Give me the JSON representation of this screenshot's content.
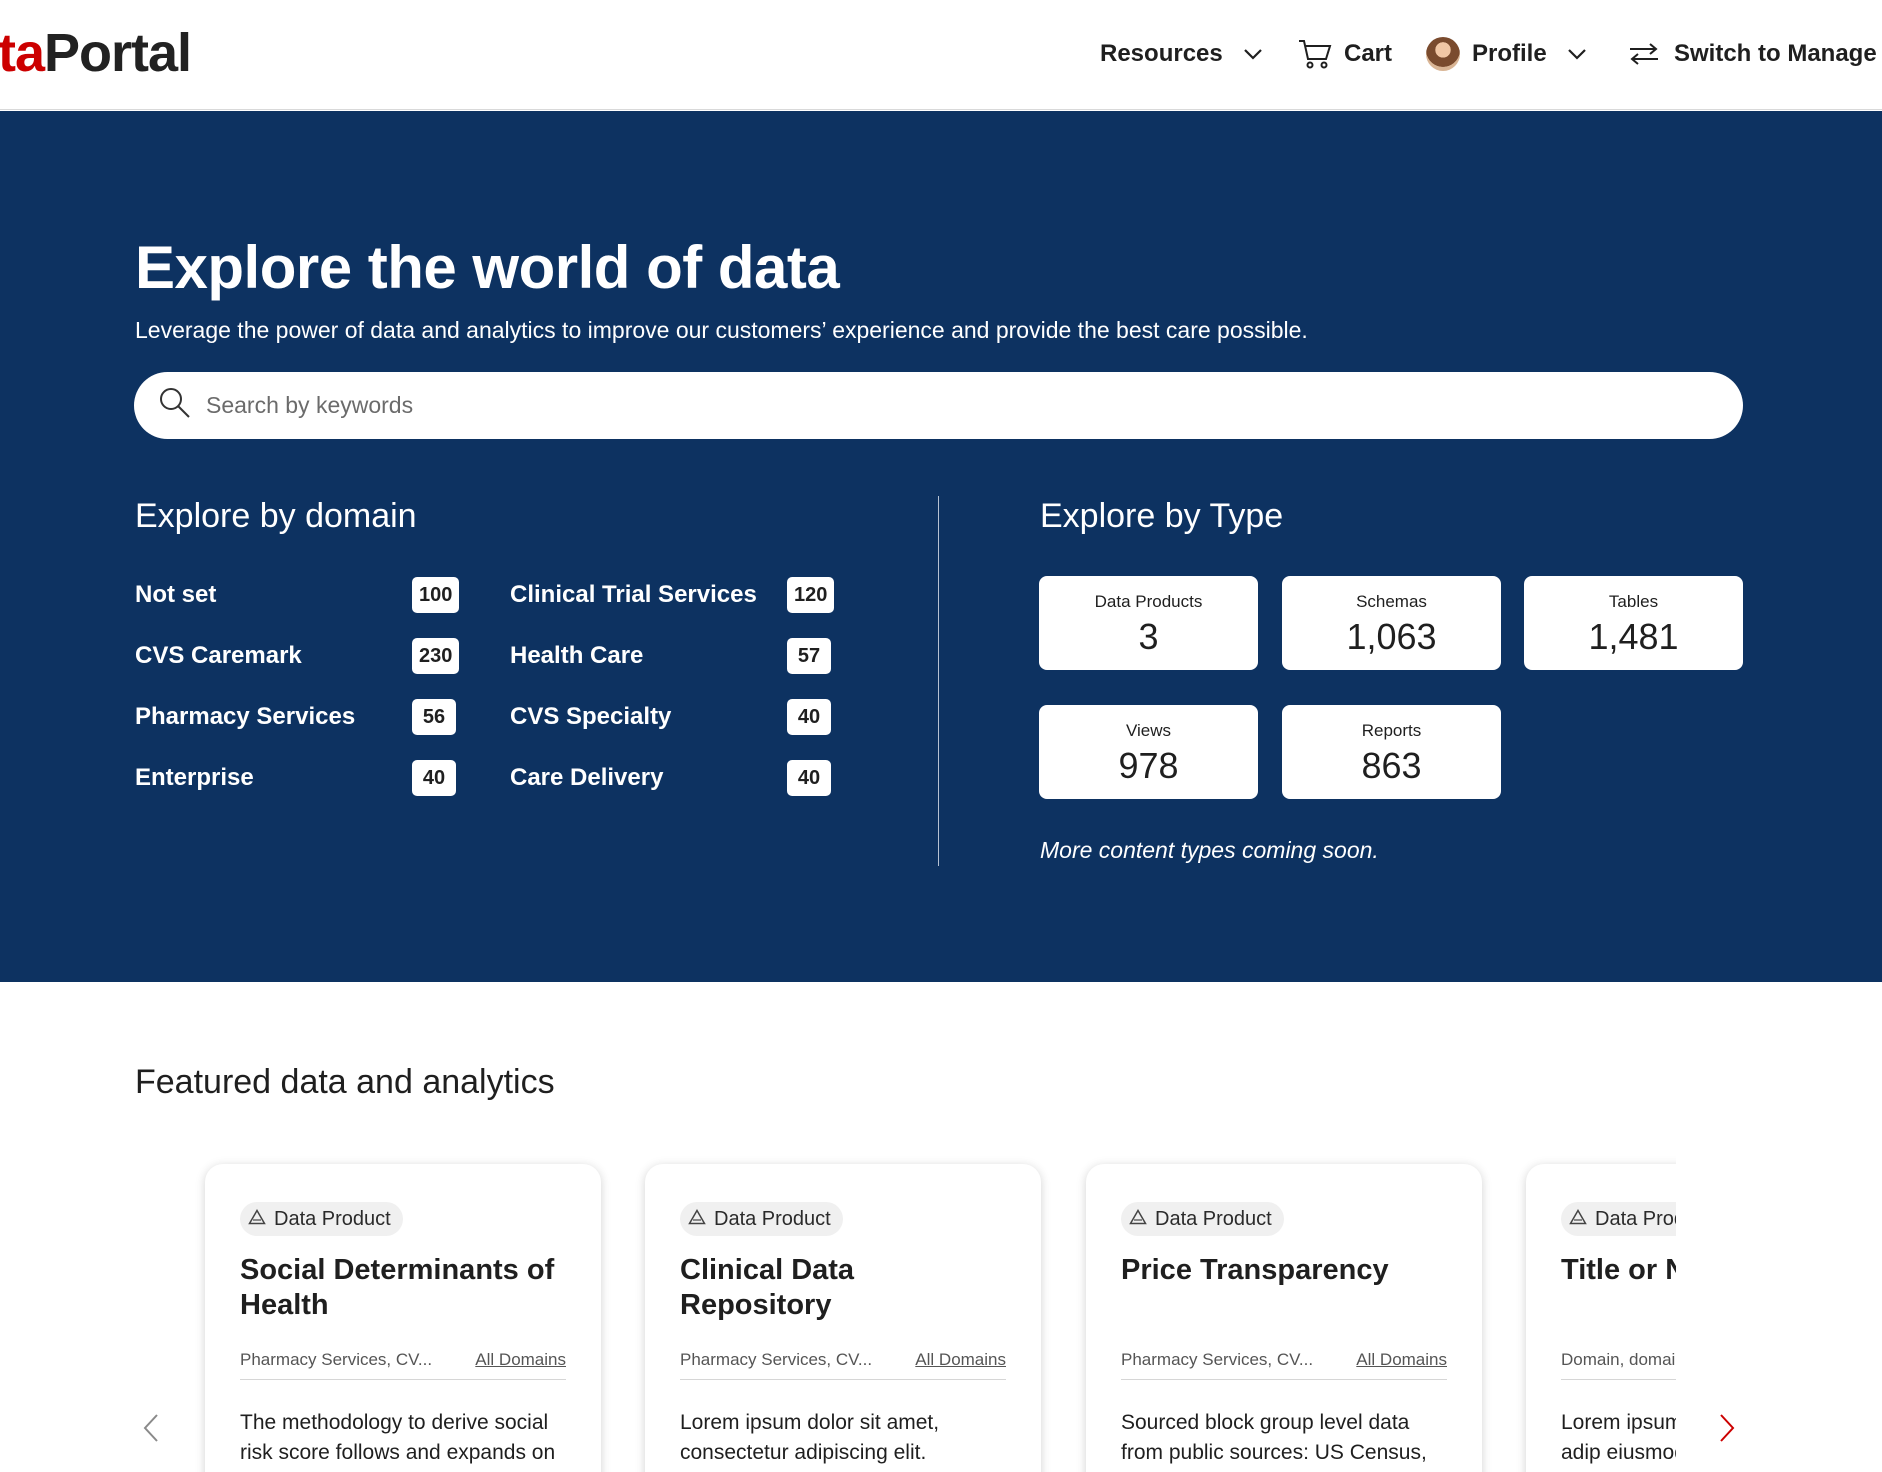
{
  "header": {
    "logo_red": "ta",
    "logo_dark": "Portal",
    "nav": {
      "resources": "Resources",
      "cart": "Cart",
      "profile": "Profile",
      "switch": "Switch to Manage V"
    }
  },
  "hero": {
    "title": "Explore the world of data",
    "subtitle": "Leverage the power of data and analytics to improve our customers’ experience and provide the best care possible.",
    "search_placeholder": "Search by keywords"
  },
  "domains": {
    "title": "Explore by domain",
    "items": [
      {
        "name": "Not set",
        "count": "100"
      },
      {
        "name": "CVS Caremark",
        "count": "230"
      },
      {
        "name": "Pharmacy Services",
        "count": "56"
      },
      {
        "name": "Enterprise",
        "count": "40"
      },
      {
        "name": "Clinical Trial Services",
        "count": "120"
      },
      {
        "name": "Health Care",
        "count": "57"
      },
      {
        "name": "CVS Specialty",
        "count": "40"
      },
      {
        "name": "Care Delivery",
        "count": "40"
      }
    ]
  },
  "types": {
    "title": "Explore by Type",
    "items": [
      {
        "label": "Data Products",
        "value": "3"
      },
      {
        "label": "Schemas",
        "value": "1,063"
      },
      {
        "label": "Tables",
        "value": "1,481"
      },
      {
        "label": "Views",
        "value": "978"
      },
      {
        "label": "Reports",
        "value": "863"
      }
    ],
    "more": "More content types coming soon."
  },
  "featured": {
    "title": "Featured data and analytics",
    "cards": [
      {
        "tag": "Data Product",
        "title": "Social Determinants of Health",
        "domains": "Pharmacy Services, CV...",
        "all_link": "All Domains",
        "desc": "The methodology to derive social risk score follows and expands on the methodology mentioned in the"
      },
      {
        "tag": "Data Product",
        "title": "Clinical Data Repository",
        "domains": "Pharmacy Services, CV...",
        "all_link": "All Domains",
        "desc": "Lorem ipsum dolor sit amet, consectetur adipiscing elit. Curabitur consequat vestibulum"
      },
      {
        "tag": "Data Product",
        "title": "Price Transparency",
        "domains": "Pharmacy Services, CV...",
        "all_link": "All Domains",
        "desc": "Sourced block group level data from public sources: US Census, Environmental protection agency"
      },
      {
        "tag": "Data Product",
        "title": "Title or Name break to",
        "domains": "Domain, domain",
        "all_link": "",
        "desc": "Lorem ipsum dolor consectetur adip eiusmod tempor"
      }
    ]
  }
}
